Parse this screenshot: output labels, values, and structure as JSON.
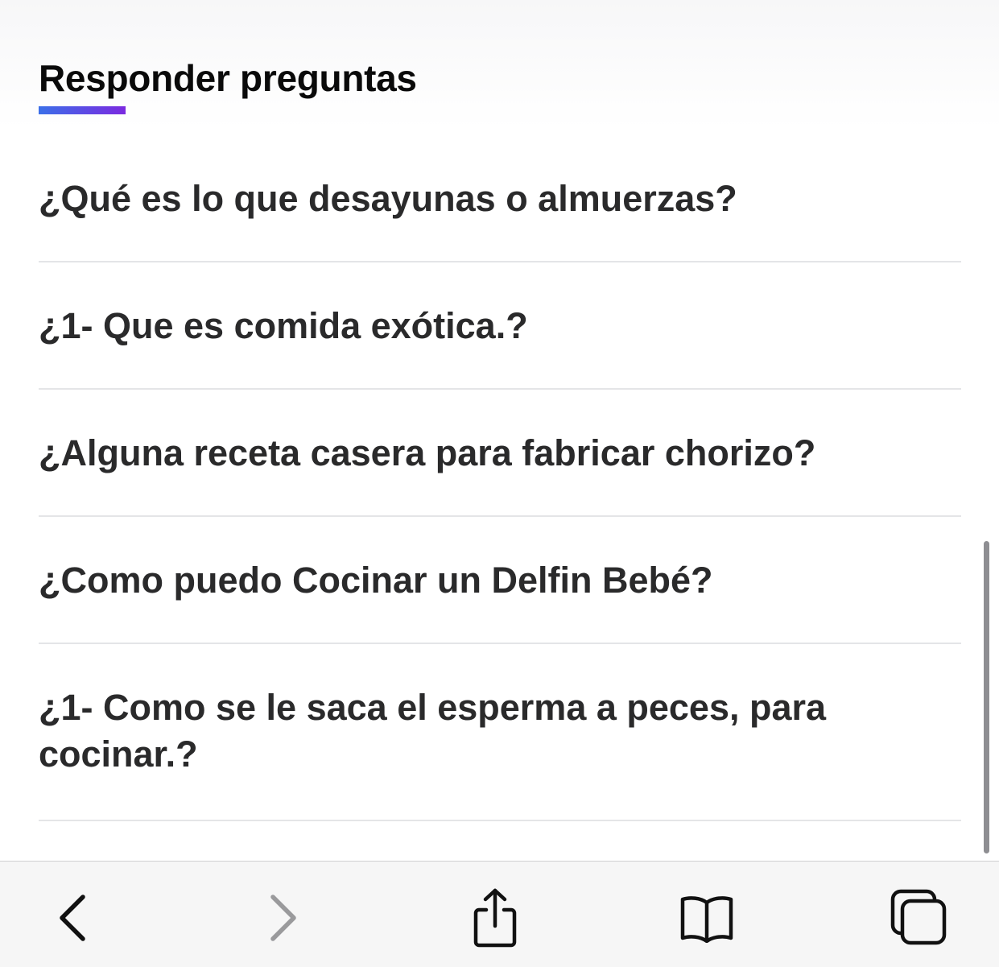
{
  "section": {
    "title": "Responder preguntas",
    "underline_gradient": [
      "#3b6fe8",
      "#7b2ae0"
    ]
  },
  "questions": [
    "¿Qué es lo que desayunas o almuerzas?",
    "¿1- Que es comida exótica.?",
    "¿Alguna receta casera para fabricar chorizo?",
    "¿Como puedo Cocinar un Delfin Bebé?",
    "¿1- Como se le saca el esperma a peces, para cocinar.?"
  ],
  "toolbar": {
    "buttons": [
      {
        "icon": "chevron-left-icon",
        "enabled": true
      },
      {
        "icon": "chevron-right-icon",
        "enabled": false
      },
      {
        "icon": "share-icon",
        "enabled": true
      },
      {
        "icon": "bookmarks-book-icon",
        "enabled": true
      },
      {
        "icon": "tabs-icon",
        "enabled": true
      }
    ]
  },
  "colors": {
    "text": "#2a2a2b",
    "title": "#0a0a0a",
    "divider": "#e4e5e7",
    "toolbar_bg": "#f6f6f6",
    "icon_active": "#111111",
    "icon_disabled": "#9a9a9c"
  }
}
